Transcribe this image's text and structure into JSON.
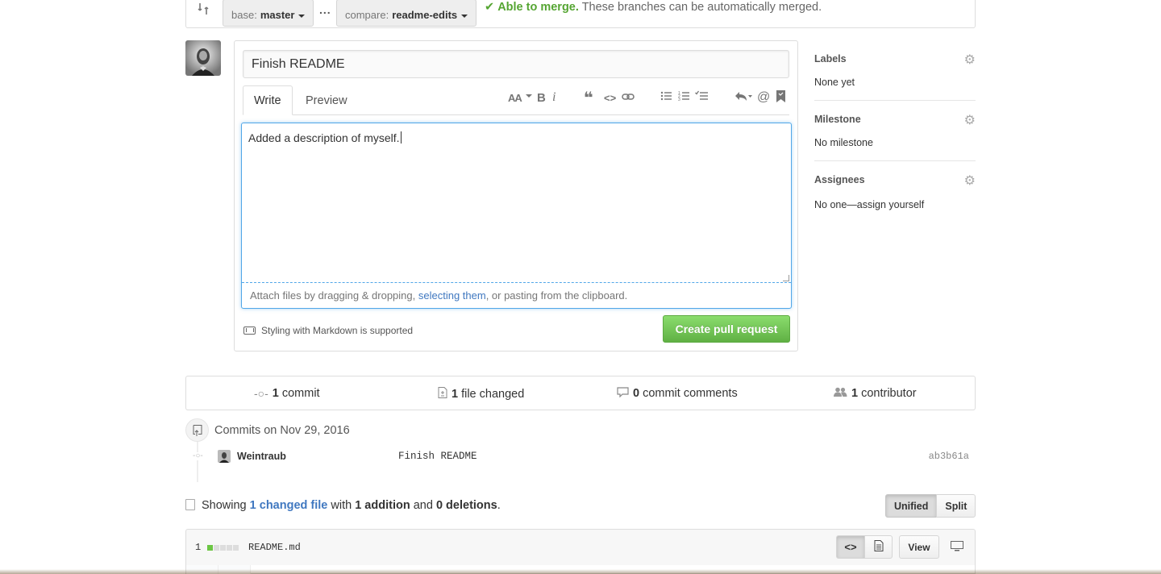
{
  "compare": {
    "base_prefix": "base:",
    "base_branch": "master",
    "separator": "...",
    "compare_prefix": "compare:",
    "compare_branch": "readme-edits",
    "merge_ok": "Able to merge.",
    "merge_msg": "These branches can be automatically merged."
  },
  "form": {
    "title_value": "Finish README",
    "tabs": {
      "write": "Write",
      "preview": "Preview"
    },
    "body_text": "Added a description of myself.",
    "attach_pre": "Attach files by dragging & dropping, ",
    "attach_link": "selecting them",
    "attach_post": ", or pasting from the clipboard.",
    "markdown_note": "Styling with Markdown is supported",
    "submit_label": "Create pull request"
  },
  "toolbar": {
    "header": "AA",
    "bold": "B",
    "italic": "i",
    "quote": "❝",
    "code": "<>",
    "mention": "@"
  },
  "sidebar": {
    "labels": {
      "title": "Labels",
      "value": "None yet"
    },
    "milestone": {
      "title": "Milestone",
      "value": "No milestone"
    },
    "assignees": {
      "title": "Assignees",
      "value": "No one—assign yourself"
    }
  },
  "summary": {
    "commits_count": "1",
    "commits_label": "commit",
    "files_count": "1",
    "files_label": "file changed",
    "comments_count": "0",
    "comments_label": "commit comments",
    "contributors_count": "1",
    "contributors_label": "contributor"
  },
  "commits": {
    "heading": "Commits on Nov 29, 2016",
    "items": [
      {
        "author": "Weintraub",
        "message": "Finish README",
        "sha": "ab3b61a"
      }
    ]
  },
  "files_summary": {
    "showing": "Showing",
    "changed_link": "1 changed file",
    "with": "with",
    "additions": "1 addition",
    "and": "and",
    "deletions": "0 deletions",
    "period": "."
  },
  "view_toggle": {
    "unified": "Unified",
    "split": "Split"
  },
  "file": {
    "changes": "1",
    "name": "README.md",
    "view_label": "View"
  },
  "colors": {
    "accent_link": "#4078c0",
    "merge_green": "#55a532",
    "button_green": "#60b044",
    "focus_blue": "#51a7e8"
  }
}
